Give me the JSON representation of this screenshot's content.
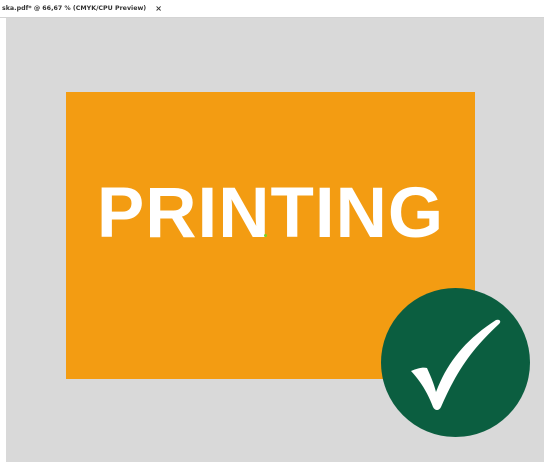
{
  "document_tab": {
    "title": "ska.pdf* @ 66,67 % (CMYK/CPU Preview)",
    "close_glyph": "×"
  },
  "artboard": {
    "text": "PRINTING",
    "background_color": "#f39c12",
    "text_color": "#ffffff"
  },
  "workspace": {
    "background_color": "#d9d9d9"
  },
  "badge": {
    "icon": "checkmark-icon",
    "circle_color": "#0b5e40",
    "check_color": "#ffffff"
  },
  "selection": {
    "anchor_color": "#7ed321"
  }
}
